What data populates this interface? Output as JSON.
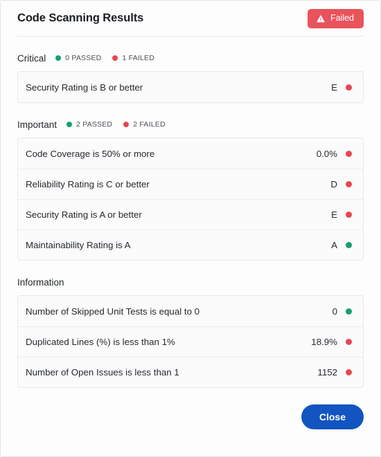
{
  "dialog": {
    "title": "Code Scanning Results",
    "status_badge": {
      "label": "Failed",
      "icon": "warning-triangle-icon",
      "color": "#e9535c"
    },
    "close_label": "Close",
    "close_color": "#1254c0"
  },
  "colors": {
    "pass": "#12a16c",
    "fail": "#e8464f",
    "accent": "#1254c0",
    "danger": "#e9535c"
  },
  "sections": [
    {
      "name": "Critical",
      "passed_label": "0 PASSED",
      "failed_label": "1 FAILED",
      "has_counts": true,
      "rows": [
        {
          "label": "Security Rating is B or better",
          "value": "E",
          "status": "fail"
        }
      ]
    },
    {
      "name": "Important",
      "passed_label": "2 PASSED",
      "failed_label": "2 FAILED",
      "has_counts": true,
      "rows": [
        {
          "label": "Code Coverage is 50% or more",
          "value": "0.0%",
          "status": "fail"
        },
        {
          "label": "Reliability Rating is C or better",
          "value": "D",
          "status": "fail"
        },
        {
          "label": "Security Rating is A or better",
          "value": "E",
          "status": "fail"
        },
        {
          "label": "Maintainability Rating is A",
          "value": "A",
          "status": "pass"
        }
      ]
    },
    {
      "name": "Information",
      "passed_label": "",
      "failed_label": "",
      "has_counts": false,
      "rows": [
        {
          "label": "Number of Skipped Unit Tests is equal to 0",
          "value": "0",
          "status": "pass"
        },
        {
          "label": "Duplicated Lines (%) is less than 1%",
          "value": "18.9%",
          "status": "fail"
        },
        {
          "label": "Number of Open Issues is less than 1",
          "value": "1152",
          "status": "fail"
        }
      ]
    }
  ]
}
